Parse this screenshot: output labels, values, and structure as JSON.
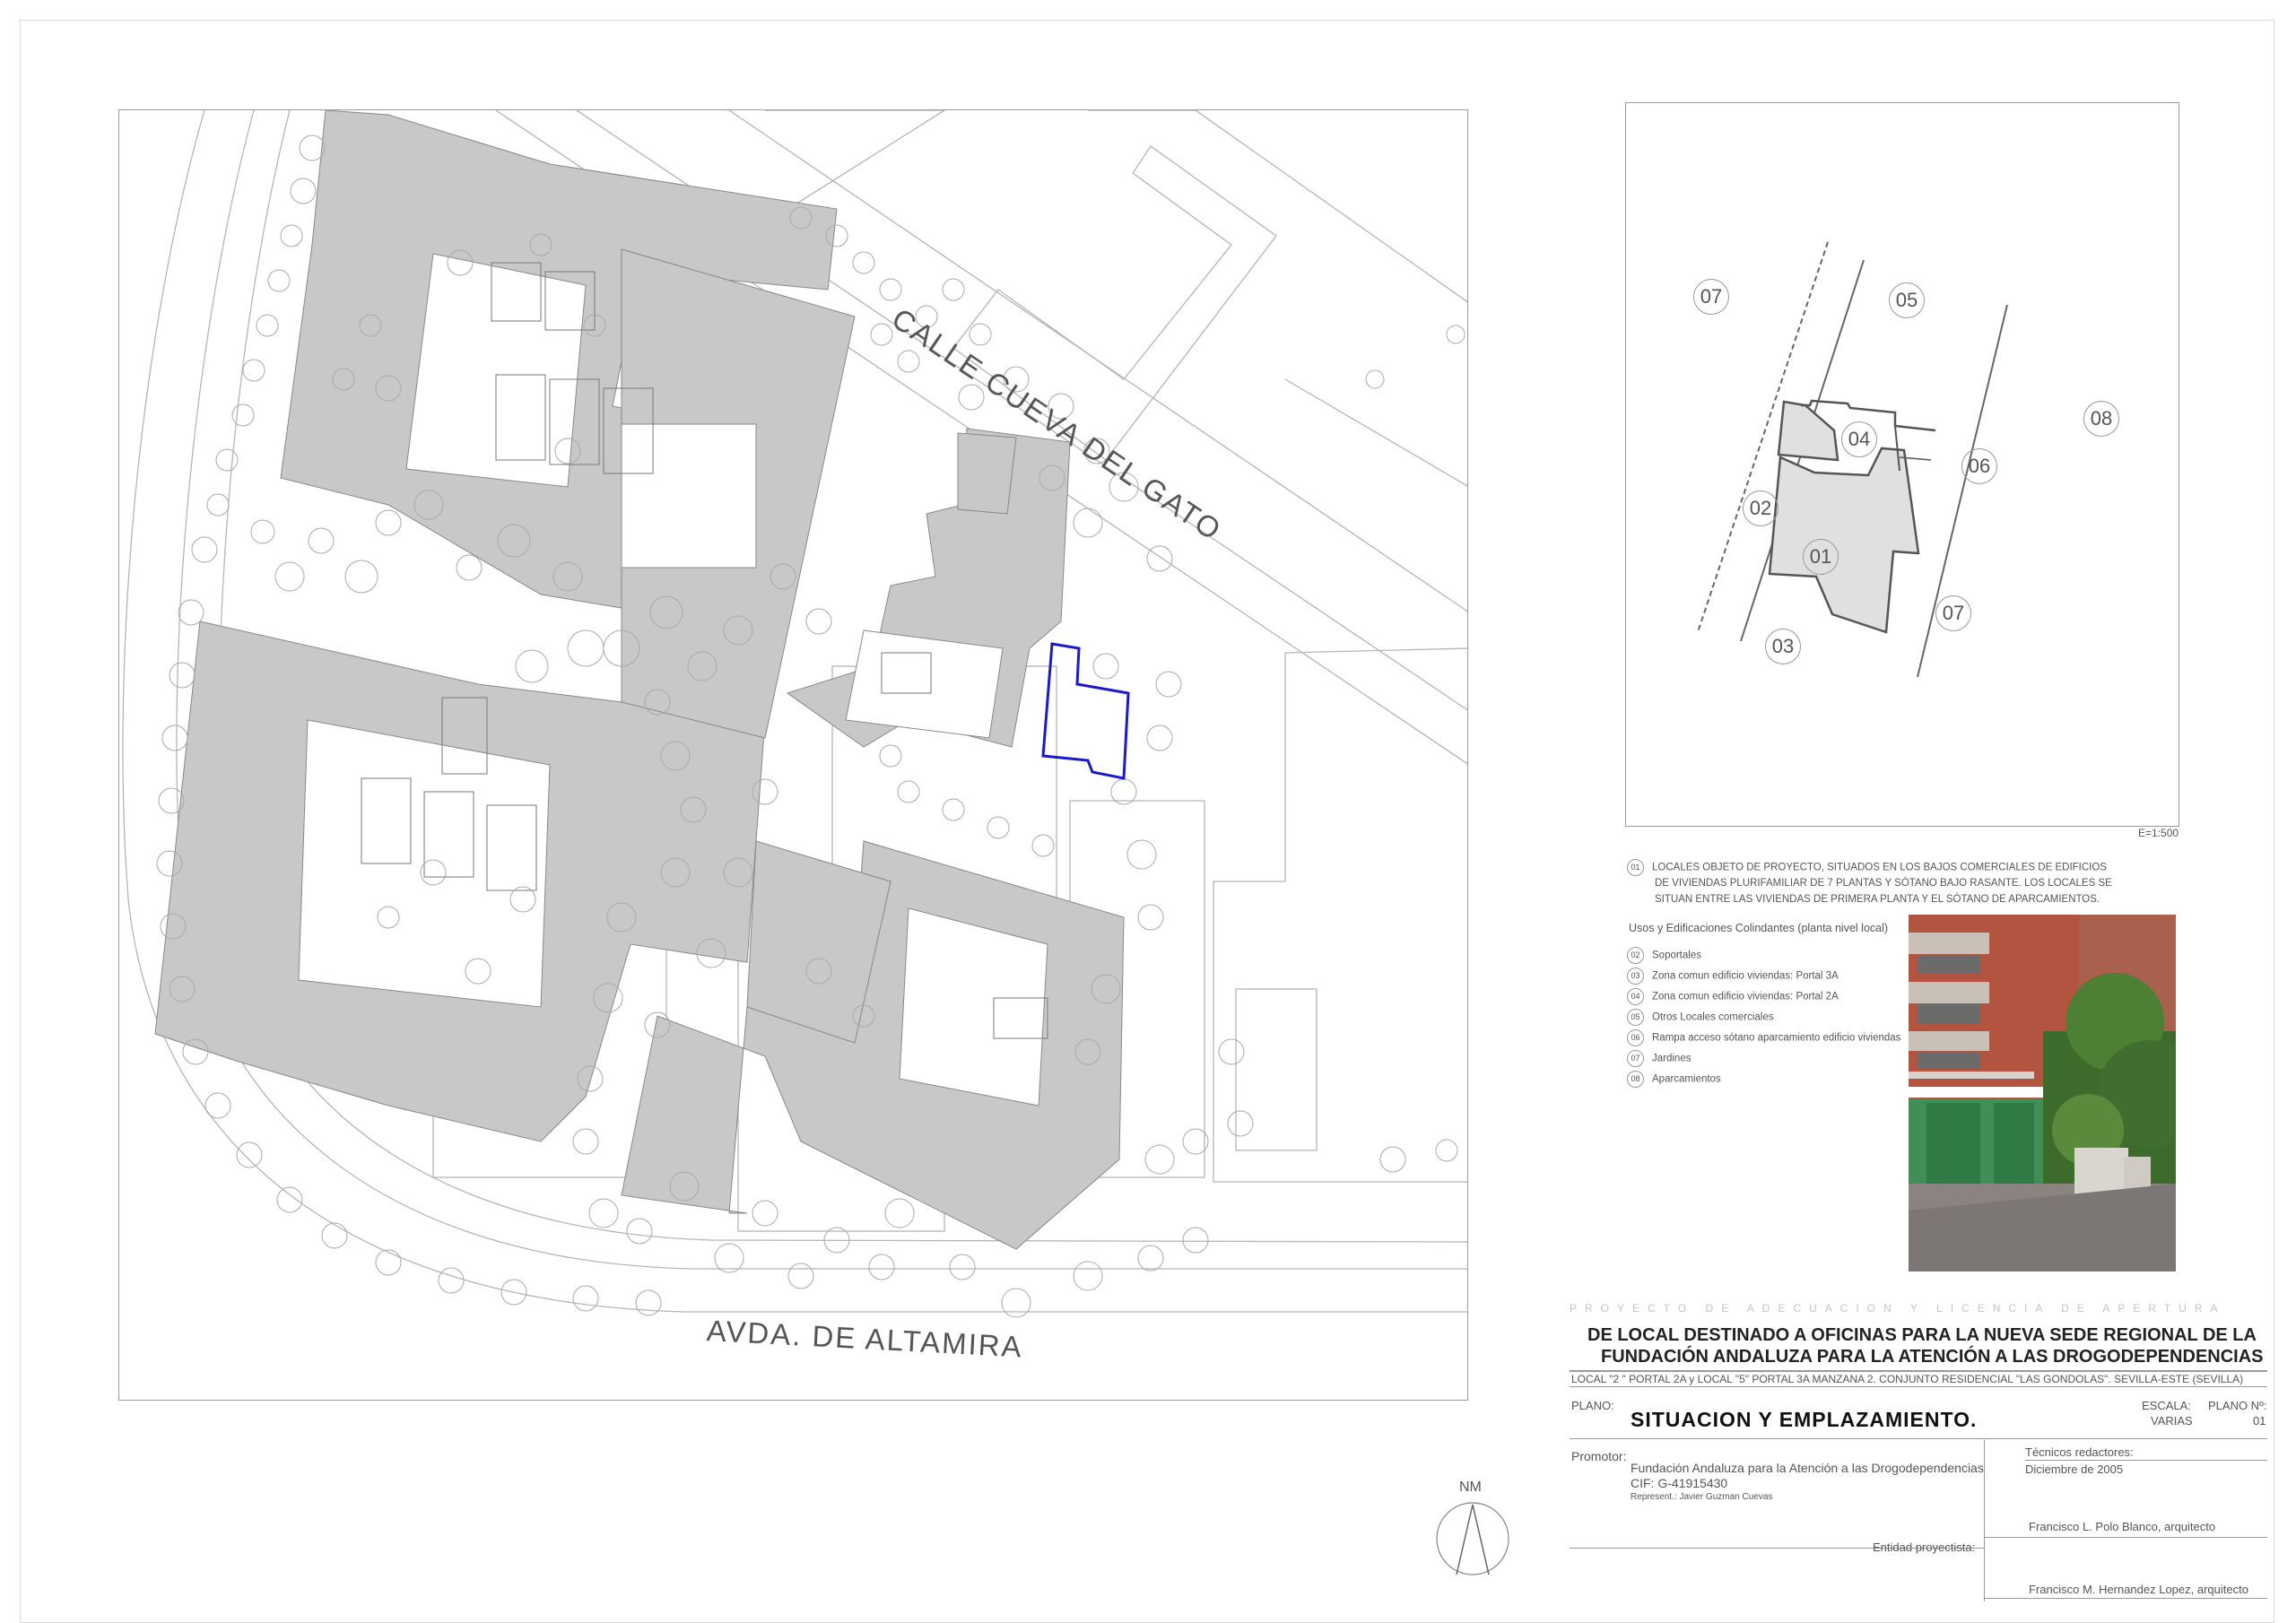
{
  "streets": {
    "calle": "CALLE CUEVA DEL GATO",
    "avenida": "AVDA. DE ALTAMIRA"
  },
  "key_plan": {
    "labels": [
      "07",
      "05",
      "08",
      "04",
      "06",
      "02",
      "01",
      "07",
      "03"
    ],
    "scale": "E=1:500"
  },
  "legend": {
    "main_num": "01",
    "main_text": [
      "LOCALES OBJETO DE PROYECTO, SITUADOS EN LOS BAJOS COMERCIALES DE EDIFICIOS",
      "DE VIVIENDAS PLURIFAMILIAR DE 7 PLANTAS Y SÓTANO BAJO RASANTE. LOS LOCALES SE",
      "SITUAN ENTRE LAS VIVIENDAS DE PRIMERA PLANTA  Y  EL SÓTANO DE APARCAMIENTOS."
    ],
    "heading": "Usos y Edificaciones Colindantes (planta nivel local)",
    "items": [
      {
        "num": "02",
        "text": "Soportales"
      },
      {
        "num": "03",
        "text": "Zona comun edificio viviendas: Portal 3A"
      },
      {
        "num": "04",
        "text": "Zona comun edificio viviendas: Portal 2A"
      },
      {
        "num": "05",
        "text": "Otros Locales comerciales"
      },
      {
        "num": "06",
        "text": "Rampa acceso sótano aparcamiento edificio viviendas"
      },
      {
        "num": "07",
        "text": "Jardines"
      },
      {
        "num": "08",
        "text": "Aparcamientos"
      }
    ]
  },
  "north": {
    "label": "NM"
  },
  "title_block": {
    "project_type": "PROYECTO  DE  ADECUACION  Y  LICENCIA  DE  APERTURA",
    "title_line1": "DE LOCAL DESTINADO A OFICINAS PARA LA NUEVA SEDE REGIONAL DE LA",
    "title_line2": "FUNDACIÓN ANDALUZA PARA LA ATENCIÓN A LAS DROGODEPENDENCIAS",
    "location": "LOCAL \"2 \" PORTAL 2A y LOCAL \"5\" PORTAL 3A   MANZANA 2.  CONJUNTO RESIDENCIAL \"LAS GONDOLAS\".  SEVILLA-ESTE  (SEVILLA)",
    "plano_label": "PLANO:",
    "plano_title": "SITUACION Y EMPLAZAMIENTO.",
    "escala_label": "ESCALA:",
    "escala_value": "VARIAS",
    "plano_num_label": "PLANO Nº:",
    "plano_num_value": "01",
    "promotor_label": "Promotor:",
    "promotor_name": "Fundación Andaluza para la Atención a las Drogodependencias",
    "promotor_cif": "CIF: G-41915430",
    "promotor_rep": "Represent.: Javier Guzman Cuevas",
    "tecnicos_label": "Técnicos redactores:",
    "fecha": "Diciembre de 2005",
    "arquitecto1": "Francisco L. Polo Blanco, arquitecto",
    "entidad_label": "Entidad proyectista:",
    "arquitecto2": "Francisco M. Hernandez Lopez, arquitecto"
  }
}
